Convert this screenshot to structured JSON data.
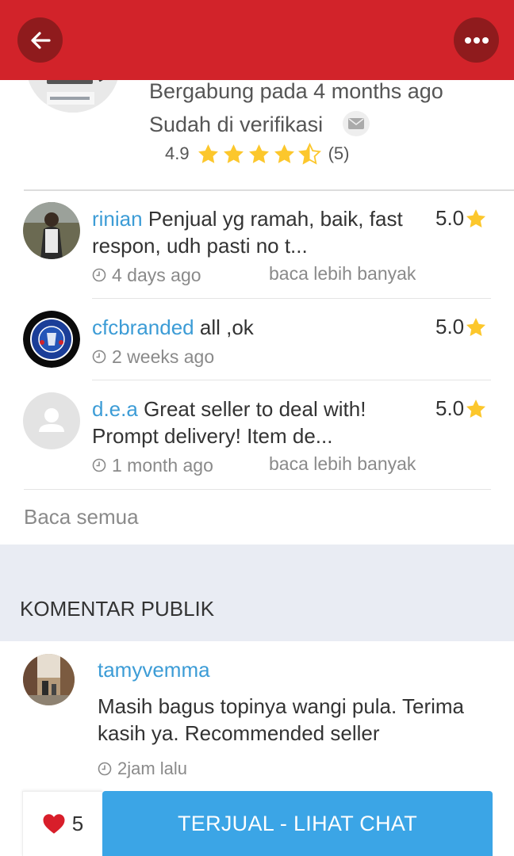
{
  "profile": {
    "joined": "Bergabung pada 4 months ago",
    "verified": "Sudah di verifikasi",
    "rating": "4.9",
    "rating_count": "(5)",
    "stars_filled": 4.5
  },
  "reviews": [
    {
      "user": "rinian",
      "text": "Penjual yg ramah, baik, fast respon, udh pasti no t...",
      "score": "5.0",
      "time": "4 days ago",
      "read_more": "baca lebih banyak"
    },
    {
      "user": "cfcbranded",
      "text": "all ,ok",
      "score": "5.0",
      "time": "2 weeks ago",
      "read_more": ""
    },
    {
      "user": "d.e.a",
      "text": "Great seller to deal with! Prompt delivery! Item de...",
      "score": "5.0",
      "time": "1 month ago",
      "read_more": "baca lebih banyak"
    }
  ],
  "read_all": "Baca semua",
  "comments_section": {
    "title": "KOMENTAR PUBLIK",
    "comment": {
      "user": "tamyvemma",
      "text": "Masih bagus topinya wangi pula. Terima kasih ya.  Recommended seller",
      "time": "2jam lalu"
    }
  },
  "bottom": {
    "likes": "5",
    "sold_button": "TERJUAL - LIHAT CHAT"
  },
  "colors": {
    "header": "#d2232a",
    "header_button": "#8f1b1d",
    "link": "#3c9cd6",
    "star": "#fcc72c",
    "primary_button": "#3ba5e6",
    "heart": "#d81e2a"
  },
  "icons": [
    "back-arrow-icon",
    "more-icon",
    "mail-icon",
    "star-icon",
    "clock-icon",
    "heart-icon",
    "person-icon"
  ]
}
